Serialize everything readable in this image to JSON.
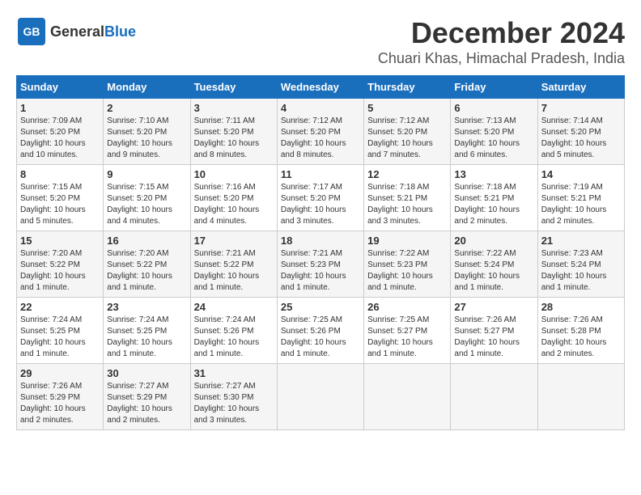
{
  "header": {
    "logo_general": "General",
    "logo_blue": "Blue",
    "month_title": "December 2024",
    "location": "Chuari Khas, Himachal Pradesh, India"
  },
  "days_of_week": [
    "Sunday",
    "Monday",
    "Tuesday",
    "Wednesday",
    "Thursday",
    "Friday",
    "Saturday"
  ],
  "weeks": [
    [
      {
        "day": "1",
        "sunrise": "7:09 AM",
        "sunset": "5:20 PM",
        "daylight": "10 hours and 10 minutes."
      },
      {
        "day": "2",
        "sunrise": "7:10 AM",
        "sunset": "5:20 PM",
        "daylight": "10 hours and 9 minutes."
      },
      {
        "day": "3",
        "sunrise": "7:11 AM",
        "sunset": "5:20 PM",
        "daylight": "10 hours and 8 minutes."
      },
      {
        "day": "4",
        "sunrise": "7:12 AM",
        "sunset": "5:20 PM",
        "daylight": "10 hours and 8 minutes."
      },
      {
        "day": "5",
        "sunrise": "7:12 AM",
        "sunset": "5:20 PM",
        "daylight": "10 hours and 7 minutes."
      },
      {
        "day": "6",
        "sunrise": "7:13 AM",
        "sunset": "5:20 PM",
        "daylight": "10 hours and 6 minutes."
      },
      {
        "day": "7",
        "sunrise": "7:14 AM",
        "sunset": "5:20 PM",
        "daylight": "10 hours and 5 minutes."
      }
    ],
    [
      {
        "day": "8",
        "sunrise": "7:15 AM",
        "sunset": "5:20 PM",
        "daylight": "10 hours and 5 minutes."
      },
      {
        "day": "9",
        "sunrise": "7:15 AM",
        "sunset": "5:20 PM",
        "daylight": "10 hours and 4 minutes."
      },
      {
        "day": "10",
        "sunrise": "7:16 AM",
        "sunset": "5:20 PM",
        "daylight": "10 hours and 4 minutes."
      },
      {
        "day": "11",
        "sunrise": "7:17 AM",
        "sunset": "5:20 PM",
        "daylight": "10 hours and 3 minutes."
      },
      {
        "day": "12",
        "sunrise": "7:18 AM",
        "sunset": "5:21 PM",
        "daylight": "10 hours and 3 minutes."
      },
      {
        "day": "13",
        "sunrise": "7:18 AM",
        "sunset": "5:21 PM",
        "daylight": "10 hours and 2 minutes."
      },
      {
        "day": "14",
        "sunrise": "7:19 AM",
        "sunset": "5:21 PM",
        "daylight": "10 hours and 2 minutes."
      }
    ],
    [
      {
        "day": "15",
        "sunrise": "7:20 AM",
        "sunset": "5:22 PM",
        "daylight": "10 hours and 1 minute."
      },
      {
        "day": "16",
        "sunrise": "7:20 AM",
        "sunset": "5:22 PM",
        "daylight": "10 hours and 1 minute."
      },
      {
        "day": "17",
        "sunrise": "7:21 AM",
        "sunset": "5:22 PM",
        "daylight": "10 hours and 1 minute."
      },
      {
        "day": "18",
        "sunrise": "7:21 AM",
        "sunset": "5:23 PM",
        "daylight": "10 hours and 1 minute."
      },
      {
        "day": "19",
        "sunrise": "7:22 AM",
        "sunset": "5:23 PM",
        "daylight": "10 hours and 1 minute."
      },
      {
        "day": "20",
        "sunrise": "7:22 AM",
        "sunset": "5:24 PM",
        "daylight": "10 hours and 1 minute."
      },
      {
        "day": "21",
        "sunrise": "7:23 AM",
        "sunset": "5:24 PM",
        "daylight": "10 hours and 1 minute."
      }
    ],
    [
      {
        "day": "22",
        "sunrise": "7:24 AM",
        "sunset": "5:25 PM",
        "daylight": "10 hours and 1 minute."
      },
      {
        "day": "23",
        "sunrise": "7:24 AM",
        "sunset": "5:25 PM",
        "daylight": "10 hours and 1 minute."
      },
      {
        "day": "24",
        "sunrise": "7:24 AM",
        "sunset": "5:26 PM",
        "daylight": "10 hours and 1 minute."
      },
      {
        "day": "25",
        "sunrise": "7:25 AM",
        "sunset": "5:26 PM",
        "daylight": "10 hours and 1 minute."
      },
      {
        "day": "26",
        "sunrise": "7:25 AM",
        "sunset": "5:27 PM",
        "daylight": "10 hours and 1 minute."
      },
      {
        "day": "27",
        "sunrise": "7:26 AM",
        "sunset": "5:27 PM",
        "daylight": "10 hours and 1 minute."
      },
      {
        "day": "28",
        "sunrise": "7:26 AM",
        "sunset": "5:28 PM",
        "daylight": "10 hours and 2 minutes."
      }
    ],
    [
      {
        "day": "29",
        "sunrise": "7:26 AM",
        "sunset": "5:29 PM",
        "daylight": "10 hours and 2 minutes."
      },
      {
        "day": "30",
        "sunrise": "7:27 AM",
        "sunset": "5:29 PM",
        "daylight": "10 hours and 2 minutes."
      },
      {
        "day": "31",
        "sunrise": "7:27 AM",
        "sunset": "5:30 PM",
        "daylight": "10 hours and 3 minutes."
      },
      null,
      null,
      null,
      null
    ]
  ],
  "labels": {
    "sunrise": "Sunrise:",
    "sunset": "Sunset:",
    "daylight": "Daylight:"
  }
}
